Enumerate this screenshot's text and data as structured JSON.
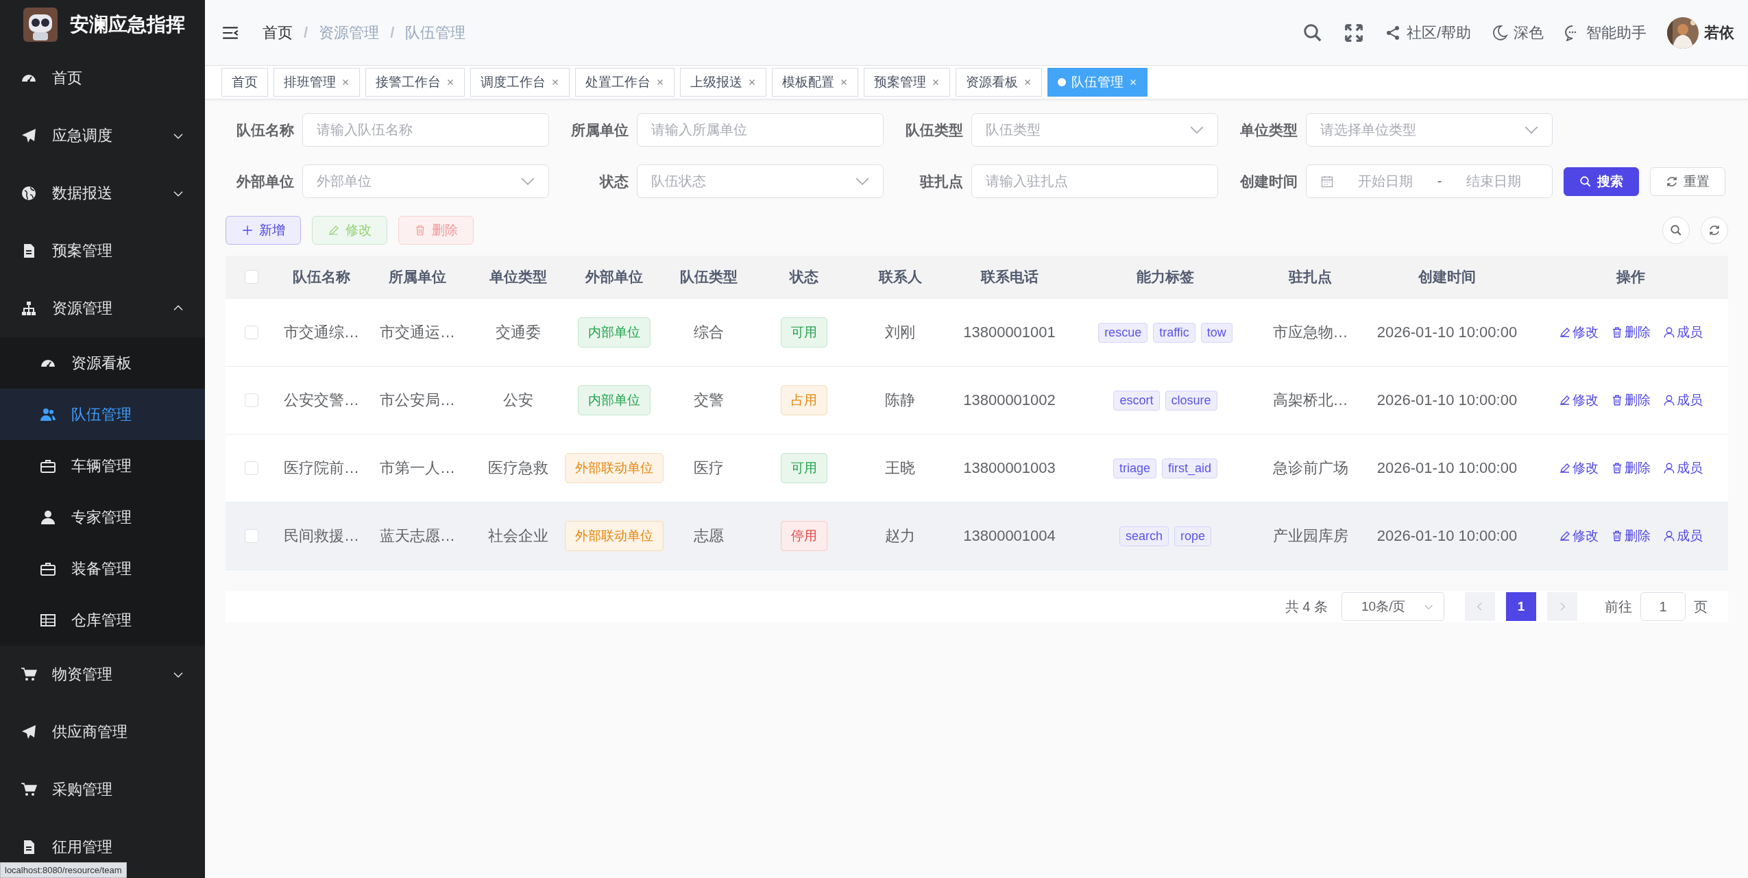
{
  "sidebar": {
    "title": "安澜应急指挥",
    "items": [
      {
        "label": "首页",
        "selected": false
      },
      {
        "label": "应急调度",
        "selected": false,
        "expanded": false
      },
      {
        "label": "数据报送",
        "selected": false,
        "expanded": false
      },
      {
        "label": "预案管理",
        "selected": false
      },
      {
        "label": "资源管理",
        "selected": false,
        "expanded": true,
        "children": [
          {
            "label": "资源看板",
            "selected": false
          },
          {
            "label": "队伍管理",
            "selected": true
          },
          {
            "label": "车辆管理",
            "selected": false
          },
          {
            "label": "专家管理",
            "selected": false
          },
          {
            "label": "装备管理",
            "selected": false
          },
          {
            "label": "仓库管理",
            "selected": false
          }
        ]
      },
      {
        "label": "物资管理",
        "selected": false,
        "expanded": false
      },
      {
        "label": "供应商管理",
        "selected": false
      },
      {
        "label": "采购管理",
        "selected": false
      },
      {
        "label": "征用管理",
        "selected": false
      }
    ]
  },
  "header": {
    "breadcrumb": [
      "首页",
      "资源管理",
      "队伍管理"
    ],
    "breadcrumb_separator": "/",
    "actions": [
      "社区/帮助",
      "深色",
      "智能助手"
    ],
    "user": {
      "name": "若依"
    }
  },
  "tabs": [
    {
      "label": "首页",
      "selected": false,
      "closable": false
    },
    {
      "label": "排班管理",
      "selected": false,
      "closable": true
    },
    {
      "label": "接警工作台",
      "selected": false,
      "closable": true
    },
    {
      "label": "调度工作台",
      "selected": false,
      "closable": true
    },
    {
      "label": "处置工作台",
      "selected": false,
      "closable": true
    },
    {
      "label": "上级报送",
      "selected": false,
      "closable": true
    },
    {
      "label": "模板配置",
      "selected": false,
      "closable": true
    },
    {
      "label": "预案管理",
      "selected": false,
      "closable": true
    },
    {
      "label": "资源看板",
      "selected": false,
      "closable": true
    },
    {
      "label": "队伍管理",
      "selected": true,
      "closable": true
    }
  ],
  "filters": [
    {
      "kind": "input",
      "label": "队伍名称",
      "placeholder": "请输入队伍名称"
    },
    {
      "kind": "input",
      "label": "所属单位",
      "placeholder": "请输入所属单位"
    },
    {
      "kind": "select",
      "label": "队伍类型",
      "placeholder": "队伍类型"
    },
    {
      "kind": "select",
      "label": "单位类型",
      "placeholder": "请选择单位类型"
    },
    {
      "kind": "select",
      "label": "外部单位",
      "placeholder": "外部单位"
    },
    {
      "kind": "select",
      "label": "状态",
      "placeholder": "队伍状态"
    },
    {
      "kind": "input",
      "label": "驻扎点",
      "placeholder": "请输入驻扎点"
    },
    {
      "kind": "daterange",
      "label": "创建时间",
      "start_placeholder": "开始日期",
      "separator": "-",
      "end_placeholder": "结束日期"
    }
  ],
  "search_button": "搜索",
  "reset_button": "重置",
  "toolbar": [
    {
      "kind": "add",
      "label": "新增",
      "disabled": false
    },
    {
      "kind": "edit",
      "label": "修改",
      "disabled": true
    },
    {
      "kind": "delete",
      "label": "删除",
      "disabled": true
    }
  ],
  "table": {
    "all_checked": false,
    "columns": [
      "队伍名称",
      "所属单位",
      "单位类型",
      "外部单位",
      "队伍类型",
      "状态",
      "联系人",
      "联系电话",
      "能力标签",
      "驻扎点",
      "创建时间",
      "操作"
    ],
    "rows": [
      {
        "checked": false,
        "hovered": false,
        "name": "市交通综…",
        "unit": "市交通运…",
        "unit_type": "交通委",
        "external": {
          "text": "内部单位",
          "kind": "internal"
        },
        "team_type": "综合",
        "status": {
          "text": "可用",
          "kind": "available"
        },
        "contact": "刘刚",
        "phone": "13800001001",
        "tags": [
          "rescue",
          "traffic",
          "tow"
        ],
        "station": "市应急物…",
        "created": "2026-01-10 10:00:00",
        "actions": [
          "修改",
          "删除",
          "成员"
        ]
      },
      {
        "checked": false,
        "hovered": false,
        "name": "公安交警…",
        "unit": "市公安局…",
        "unit_type": "公安",
        "external": {
          "text": "内部单位",
          "kind": "internal"
        },
        "team_type": "交警",
        "status": {
          "text": "占用",
          "kind": "occupied"
        },
        "contact": "陈静",
        "phone": "13800001002",
        "tags": [
          "escort",
          "closure"
        ],
        "station": "高架桥北…",
        "created": "2026-01-10 10:00:00",
        "actions": [
          "修改",
          "删除",
          "成员"
        ]
      },
      {
        "checked": false,
        "hovered": false,
        "name": "医疗院前…",
        "unit": "市第一人…",
        "unit_type": "医疗急救",
        "external": {
          "text": "外部联动单位",
          "kind": "external"
        },
        "team_type": "医疗",
        "status": {
          "text": "可用",
          "kind": "available"
        },
        "contact": "王晓",
        "phone": "13800001003",
        "tags": [
          "triage",
          "first_aid"
        ],
        "station": "急诊前广场",
        "created": "2026-01-10 10:00:00",
        "actions": [
          "修改",
          "删除",
          "成员"
        ]
      },
      {
        "checked": false,
        "hovered": true,
        "name": "民间救援…",
        "unit": "蓝天志愿…",
        "unit_type": "社会企业",
        "external": {
          "text": "外部联动单位",
          "kind": "external"
        },
        "team_type": "志愿",
        "status": {
          "text": "停用",
          "kind": "disabled"
        },
        "contact": "赵力",
        "phone": "13800001004",
        "tags": [
          "search",
          "rope"
        ],
        "station": "产业园库房",
        "created": "2026-01-10 10:00:00",
        "actions": [
          "修改",
          "删除",
          "成员"
        ]
      }
    ]
  },
  "pagination": {
    "total": "共 4 条",
    "page_size": "10条/页",
    "pages": [
      {
        "label": "1",
        "selected": true
      }
    ],
    "goto": "前往",
    "goto_value": "1",
    "goto_suffix": "页"
  },
  "status_url": "localhost:8080/resource/team"
}
